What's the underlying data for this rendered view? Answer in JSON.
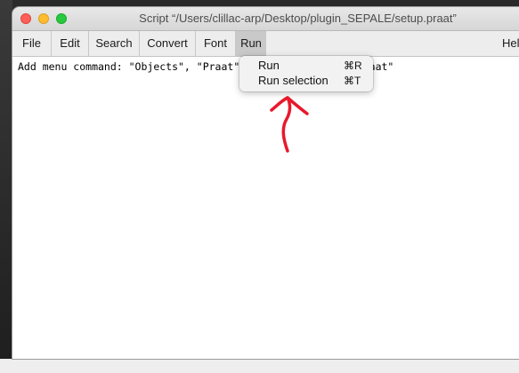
{
  "window": {
    "title": "Script “/Users/clillac-arp/Desktop/plugin_SEPALE/setup.praat”"
  },
  "menubar": {
    "items": [
      {
        "label": "File"
      },
      {
        "label": "Edit"
      },
      {
        "label": "Search"
      },
      {
        "label": "Convert"
      },
      {
        "label": "Font"
      },
      {
        "label": "Run"
      },
      {
        "label": "Help"
      }
    ]
  },
  "editor": {
    "line1": "Add menu command: \"Objects\", \"Praat\"",
    "line1_tail": "0, \"mainGUI.praat\""
  },
  "run_menu": {
    "items": [
      {
        "label": "Run",
        "shortcut": "⌘R"
      },
      {
        "label": "Run selection",
        "shortcut": "⌘T"
      }
    ]
  },
  "colors": {
    "annotation_arrow": "#e8192c",
    "active_menu": "#c9c9c9"
  }
}
